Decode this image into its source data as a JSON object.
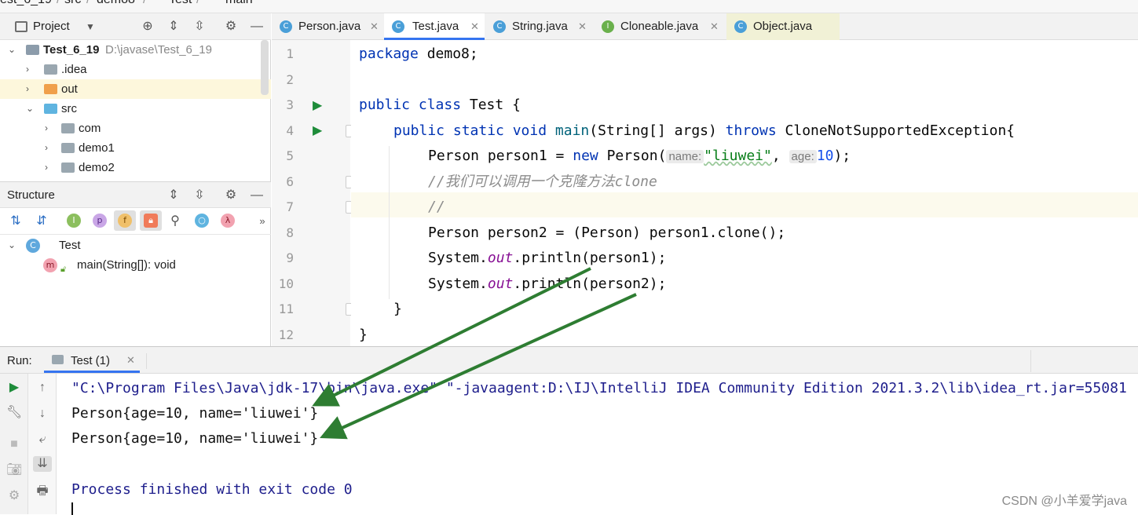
{
  "breadcrumb": {
    "items": [
      "est_6_19",
      "src",
      "demo8",
      "Test",
      "main"
    ],
    "sep": "/"
  },
  "project_panel": {
    "title": "Project",
    "root": {
      "name": "Test_6_19",
      "path": "D:\\javase\\Test_6_19"
    },
    "items": [
      ".idea",
      "out",
      "src",
      "com",
      "demo1",
      "demo2"
    ]
  },
  "structure_panel": {
    "title": "Structure",
    "class_name": "Test",
    "method": "main(String[]): void"
  },
  "editor_tabs": [
    {
      "label": "Person.java",
      "icon": "C"
    },
    {
      "label": "Test.java",
      "icon": "C"
    },
    {
      "label": "String.java",
      "icon": "C"
    },
    {
      "label": "Cloneable.java",
      "icon": "I"
    },
    {
      "label": "Object.java",
      "icon": "C"
    }
  ],
  "line_numbers": [
    "1",
    "2",
    "3",
    "4",
    "5",
    "6",
    "7",
    "8",
    "9",
    "10",
    "11",
    "12"
  ],
  "code": {
    "l1_kw": "package",
    "l1_rest": " demo8;",
    "l3_kw": "public class",
    "l3_rest": " Test {",
    "l4_kw1": "public static void",
    "l4_fn": "main",
    "l4_mid": "(String[] args) ",
    "l4_kw2": "throws",
    "l4_rest": " CloneNotSupportedException{",
    "l5_a": "Person person1 = ",
    "l5_kw": "new",
    "l5_b": " Person(",
    "l5_hint1": "name:",
    "l5_str": "\"liuwei\"",
    "l5_c": ", ",
    "l5_hint2": "age:",
    "l5_num": "10",
    "l5_d": ");",
    "l6_comment": "//我们可以调用一个克隆方法clone",
    "l7_comment": "//",
    "l8": "Person person2 = (Person) person1.clone();",
    "l9_a": "System.",
    "l9_fld": "out",
    "l9_b": ".println(person1);",
    "l10_a": "System.",
    "l10_fld": "out",
    "l10_b": ".println(person2);",
    "l11": "}",
    "l12": "}"
  },
  "run": {
    "label": "Run:",
    "tab": "Test (1)",
    "console": [
      "\"C:\\Program Files\\Java\\jdk-17\\bin\\java.exe\" \"-javaagent:D:\\IJ\\IntelliJ IDEA Community Edition 2021.3.2\\lib\\idea_rt.jar=55081",
      "Person{age=10, name='liuwei'}",
      "Person{age=10, name='liuwei'}",
      "",
      "Process finished with exit code 0"
    ]
  },
  "watermark": "CSDN @小羊爱学java",
  "colors": {
    "accent": "#3574f0",
    "arrow": "#2e7d32",
    "run_green": "#1e8c3a"
  }
}
